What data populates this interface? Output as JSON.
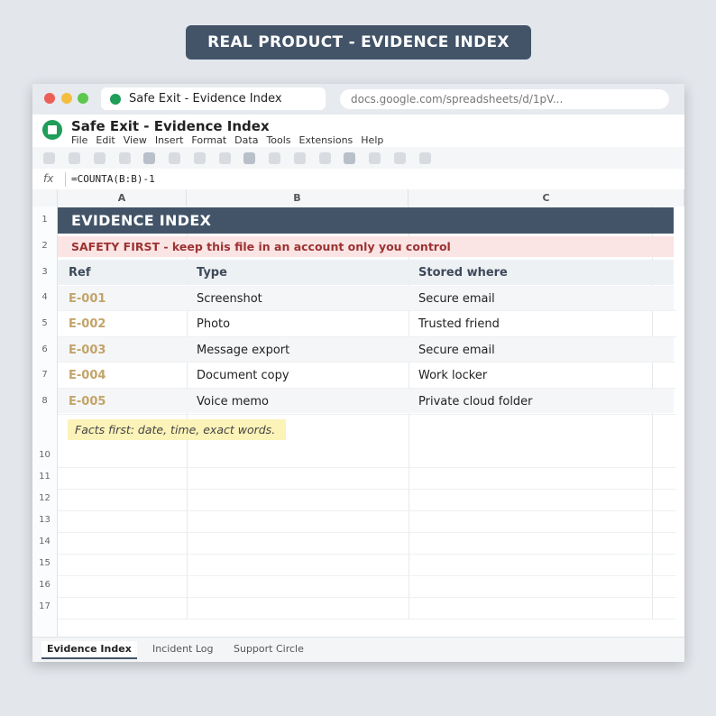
{
  "banner": {
    "title": "REAL PRODUCT - EVIDENCE INDEX"
  },
  "browser": {
    "tab_title": "Safe Exit - Evidence Index",
    "url": "docs.google.com/spreadsheets/d/1pV..."
  },
  "app": {
    "doc_title": "Safe Exit - Evidence Index",
    "menu": [
      "File",
      "Edit",
      "View",
      "Insert",
      "Format",
      "Data",
      "Tools",
      "Extensions",
      "Help"
    ]
  },
  "formula_bar": {
    "label": "fx",
    "formula": "=COUNTA(B:B)-1"
  },
  "columns": [
    "A",
    "B",
    "C"
  ],
  "row_numbers": [
    "1",
    "2",
    "3",
    "4",
    "5",
    "6",
    "7",
    "8",
    "10",
    "11",
    "12",
    "13",
    "14",
    "15",
    "16",
    "17"
  ],
  "sheet": {
    "title": "EVIDENCE INDEX",
    "safety_note": "SAFETY FIRST - keep this file in an account only you control",
    "headers": [
      "Ref",
      "Type",
      "Stored where"
    ],
    "rows": [
      [
        "E-001",
        "Screenshot",
        "Secure email"
      ],
      [
        "E-002",
        "Photo",
        "Trusted friend"
      ],
      [
        "E-003",
        "Message export",
        "Secure email"
      ],
      [
        "E-004",
        "Document copy",
        "Work locker"
      ],
      [
        "E-005",
        "Voice memo",
        "Private cloud folder"
      ]
    ],
    "tip": "Facts first: date, time, exact words."
  },
  "sheet_tabs": [
    "Evidence Index",
    "Incident Log",
    "Support Circle"
  ],
  "colors": {
    "banner": "#435469",
    "ref": "#c3a46a",
    "safety_bg": "#fbe4e4",
    "safety_text": "#9c3232",
    "tip_bg": "#fbf3b8",
    "app_icon": "#1e9e58"
  }
}
